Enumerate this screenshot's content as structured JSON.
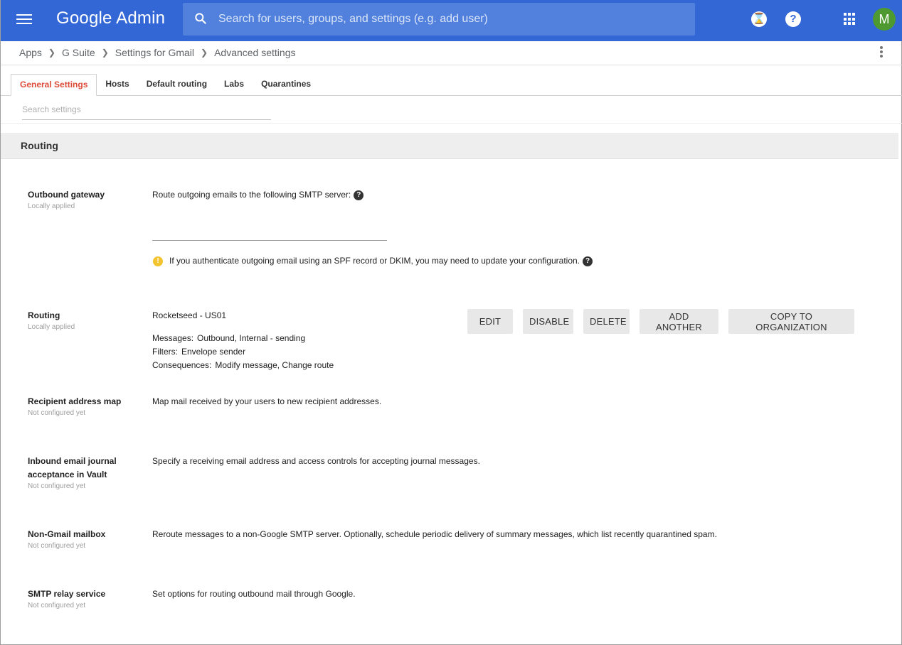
{
  "header": {
    "app_title": "Google Admin",
    "search_placeholder": "Search for users, groups, and settings (e.g. add user)",
    "icons": [
      "menu-icon",
      "search-icon",
      "hourglass-icon",
      "help-icon",
      "apps-grid-icon"
    ],
    "hourglass_glyph": "⌛",
    "help_glyph": "?",
    "avatar_initial": "M",
    "avatar_color": "#4e9a31",
    "brand_color": "#3367d6"
  },
  "breadcrumb": [
    "Apps",
    "G Suite",
    "Settings for Gmail",
    "Advanced settings"
  ],
  "tabs": [
    {
      "label": "General Settings",
      "active": true
    },
    {
      "label": "Hosts",
      "active": false
    },
    {
      "label": "Default routing",
      "active": false
    },
    {
      "label": "Labs",
      "active": false
    },
    {
      "label": "Quarantines",
      "active": false
    }
  ],
  "settings_search": {
    "placeholder": "Search settings",
    "value": ""
  },
  "section": {
    "title": "Routing"
  },
  "rows": {
    "outbound_gateway": {
      "label": "Outbound gateway",
      "status": "Locally applied",
      "description": "Route outgoing emails to the following SMTP server:",
      "smtp_value": "",
      "warning": "If you authenticate outgoing email using an SPF record or DKIM, you may need to update your configuration."
    },
    "routing": {
      "label": "Routing",
      "status": "Locally applied",
      "rule_name": "Rocketseed - US01",
      "messages_label": "Messages:",
      "messages_value": "Outbound, Internal - sending",
      "filters_label": "Filters:",
      "filters_value": "Envelope sender",
      "consequences_label": "Consequences:",
      "consequences_value": "Modify message, Change route",
      "buttons": {
        "edit": "EDIT",
        "disable": "DISABLE",
        "delete": "DELETE",
        "add_another": "ADD ANOTHER",
        "copy_to_org": "COPY TO ORGANIZATION"
      }
    },
    "recipient_address_map": {
      "label": "Recipient address map",
      "status": "Not configured yet",
      "description": "Map mail received by your users to new recipient addresses."
    },
    "inbound_journal": {
      "label": "Inbound email journal acceptance in Vault",
      "status": "Not configured yet",
      "description": "Specify a receiving email address and access controls for accepting journal messages."
    },
    "non_gmail_mailbox": {
      "label": "Non-Gmail mailbox",
      "status": "Not configured yet",
      "description": "Reroute messages to a non-Google SMTP server. Optionally, schedule periodic delivery of summary messages, which list recently quarantined spam."
    },
    "smtp_relay": {
      "label": "SMTP relay service",
      "status": "Not configured yet",
      "description": "Set options for routing outbound mail through Google."
    }
  }
}
